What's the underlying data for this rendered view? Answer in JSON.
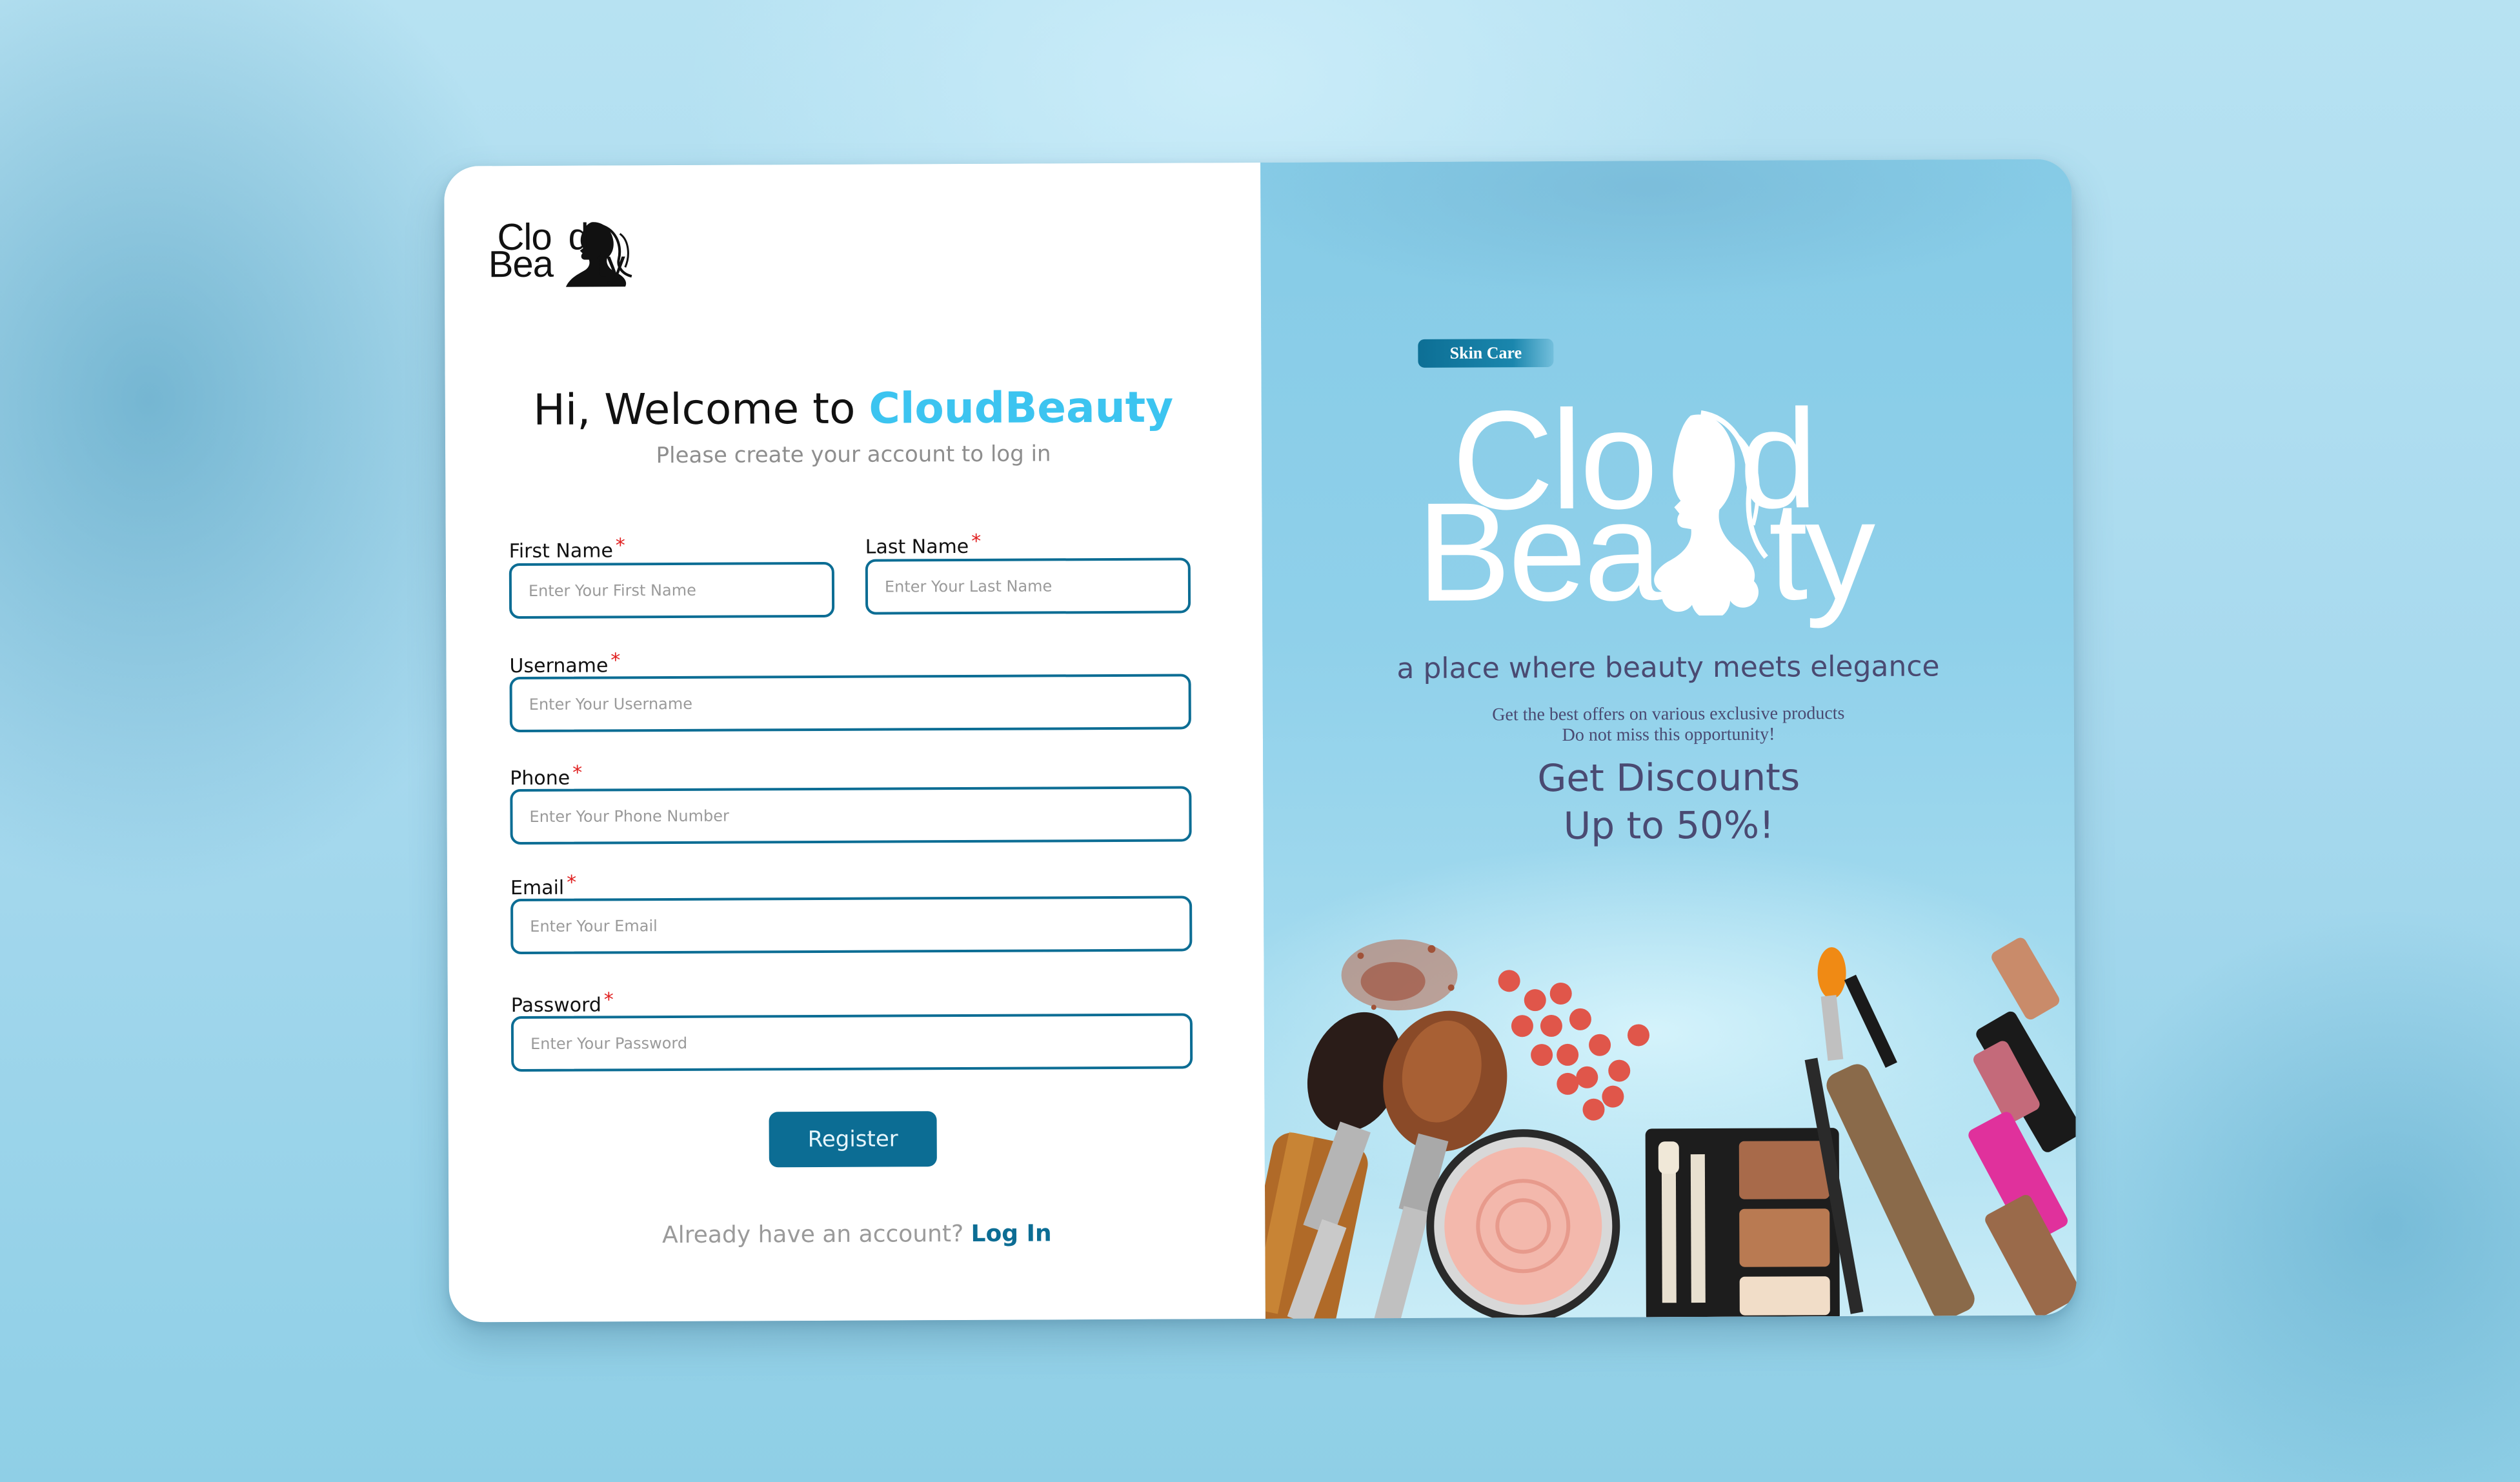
{
  "logo": {
    "word1": "Cloud",
    "word2": "Beauty",
    "word1_text": "Clo",
    "word1_end": "d",
    "word2_start": "Bea",
    "word2_end": "ty"
  },
  "form": {
    "greeting": "Hi, Welcome to ",
    "brand_name": "CloudBeauty",
    "subtitle": "Please create your account to log in",
    "required_mark": "*",
    "fields": {
      "first_name": {
        "label": "First Name",
        "placeholder": "Enter Your First Name"
      },
      "last_name": {
        "label": "Last Name",
        "placeholder": "Enter Your Last Name"
      },
      "username": {
        "label": "Username",
        "placeholder": "Enter Your Username"
      },
      "phone": {
        "label": "Phone",
        "placeholder": "Enter Your Phone Number"
      },
      "email": {
        "label": "Email",
        "placeholder": "Enter Your Email"
      },
      "password": {
        "label": "Password",
        "placeholder": "Enter Your Password"
      }
    },
    "register_label": "Register",
    "already_text": "Already have an account? ",
    "login_label": "Log In"
  },
  "promo": {
    "tag": "Skin Care",
    "tagline": "a place where beauty meets elegance",
    "offer_line1": "Get the best offers on various exclusive products",
    "offer_line2": "Do not miss this opportunity!",
    "discount_line1": "Get Discounts",
    "discount_line2": "Up to 50%!"
  },
  "colors": {
    "accent": "#0c6d94",
    "brand": "#3cc4f0",
    "required": "#e02020",
    "promo_text": "#4a4a72",
    "panel_bg": "#8fd0ea"
  },
  "icons": {
    "logo_mark": "woman-silhouette-icon",
    "illustration": "makeup-products-illustration"
  }
}
